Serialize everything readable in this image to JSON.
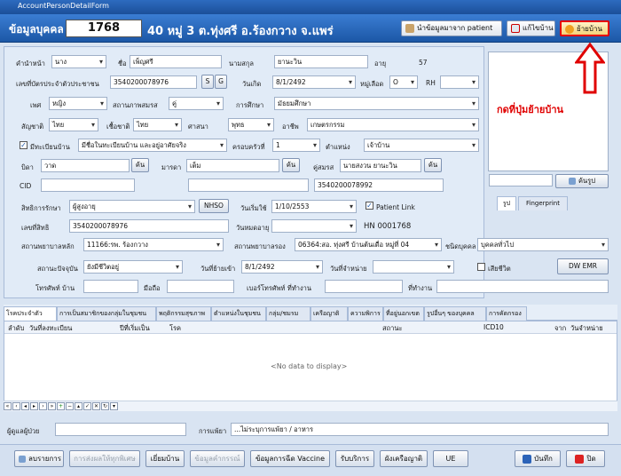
{
  "window": {
    "title": "AccountPersonDetailForm"
  },
  "header": {
    "title": "ข้อมูลบุคคล",
    "person_id": "1768",
    "address": "40 หมู่ 3 ต.ทุ่งศรี อ.ร้องกวาง จ.แพร่",
    "buttons": {
      "import": "นำข้อมูลมาจาก patient",
      "edit_house": "แก้ไขบ้าน",
      "move_house": "ย้ายบ้าน"
    }
  },
  "form": {
    "prefix_label": "คำนำหน้า",
    "prefix": "นาง",
    "fname_label": "ชื่อ",
    "fname": "เพ็ญศรี",
    "lname_label": "นามสกุล",
    "lname": "ยานะวิน",
    "age_label": "อายุ",
    "age": "57",
    "cid_label": "เลขที่บัตรประจำตัวประชาชน",
    "cid": "3540200078976",
    "s_btn": "S",
    "g_btn": "G",
    "dob_label": "วันเกิด",
    "dob": "8/1/2492",
    "blood_label": "หมู่เลือด",
    "blood": "O",
    "rh": "RH",
    "sex_label": "เพศ",
    "sex": "หญิง",
    "marital_label": "สถานภาพสมรส",
    "marital": "คู่",
    "edu_label": "การศึกษา",
    "edu": "มัธยมศึกษา",
    "nation_label": "สัญชาติ",
    "nation": "ไทย",
    "race_label": "เชื้อชาติ",
    "race": "ไทย",
    "religion_label": "ศาสนา",
    "religion": "พุทธ",
    "occ_label": "อาชีพ",
    "occ": "เกษตรกรรม",
    "house_reg_label": "มีทะเบียนบ้าน",
    "house_reg": "มีชื่อในทะเบียนบ้าน และอยู่อาศัยจริง",
    "family_label": "ครอบครัวที่",
    "family": "1",
    "position_label": "ตำแหน่ง",
    "position": "เจ้าบ้าน",
    "father_label": "บิดา",
    "father": "วาด",
    "mother_label": "มารดา",
    "mother": "เต็ม",
    "spouse_label": "คู่สมรส",
    "spouse": "นายสงวน ยานะวิน",
    "find_btn": "ค้น",
    "cid2_label": "CID",
    "cid2": "3540200078992",
    "right_label": "สิทธิการรักษา",
    "right": "ผู้สูงอายุ",
    "nhso_btn": "NHSO",
    "use_date_label": "วันเริ่มใช้",
    "use_date": "1/10/2553",
    "patient_link": "Patient Link",
    "right_no_label": "เลขที่สิทธิ",
    "right_no": "3540200078976",
    "expire_label": "วันหมดอายุ",
    "hn": "HN  0001768",
    "main_hosp_label": "สถานพยาบาลหลัก",
    "main_hosp": "11166:รพ. ร้องกวาง",
    "sub_hosp_label": "สถานพยาบาลรอง",
    "sub_hosp": "06364:สอ. ทุ่งศรี บ้านต้นเดื่อ หมู่ที่ 04",
    "type_label": "ชนิดบุคคล",
    "type": "บุคคลทั่วไป",
    "status_label": "สถานะปัจจุบัน",
    "status": "ยังมีชีวิตอยู่",
    "movein_label": "วันที่ย้ายเข้า",
    "movein": "8/1/2492",
    "discharge_label": "วันที่จำหน่าย",
    "dead_label": "เสียชีวิต",
    "dwemr_btn": "DW EMR",
    "phone_label": "โทรศัพท์ บ้าน",
    "mobile_label": "มือถือ",
    "work_phone_label": "เบอร์โทรศัพท์ ที่ทำงาน",
    "workplace_label": "ที่ทำงาน"
  },
  "photo": {
    "annotation": "กดที่ปุ่มย้ายบ้าน",
    "find_photo": "ค้นรูป",
    "tab_photo": "รูป",
    "tab_fp": "Fingerprint"
  },
  "tabs": [
    "โรคประจำตัว",
    "การเป็นสมาชิกของกลุ่มในชุมชน",
    "พฤติกรรมสุขภาพ",
    "ตำแหน่งในชุมชน",
    "กลุ่ม/ชมรม",
    "เครือญาติ",
    "ความพิการ",
    "ที่อยู่นอกเขต",
    "รูปอื่นๆ ของบุคคล",
    "การคัดกรอง"
  ],
  "grid": {
    "columns": [
      "ลำดับ",
      "วันที่ลงทะเบียน",
      "ปีที่เริ่มเป็น",
      "โรค",
      "สถานะ",
      "ICD10",
      "จาก",
      "วันจำหน่าย"
    ],
    "empty": "<No data to display>"
  },
  "footer": {
    "recorder_label": "ผู้ดูแลผู้ป่วย",
    "allergy_label": "การแพ้ยา",
    "allergy": "...ไม่ระบุการแพ้ยา / อาหาร",
    "buttons": [
      "ลบรายการ",
      "การส่งผลให้ทุกพิเศษ",
      "เยี่ยมบ้าน",
      "ข้อมูลคำกรรณ์",
      "ข้อมูลการฉีด Vaccine",
      "รับบริการ",
      "ผังเครือญาติ",
      "UE"
    ],
    "save": "บันทึก",
    "close": "ปิด"
  }
}
